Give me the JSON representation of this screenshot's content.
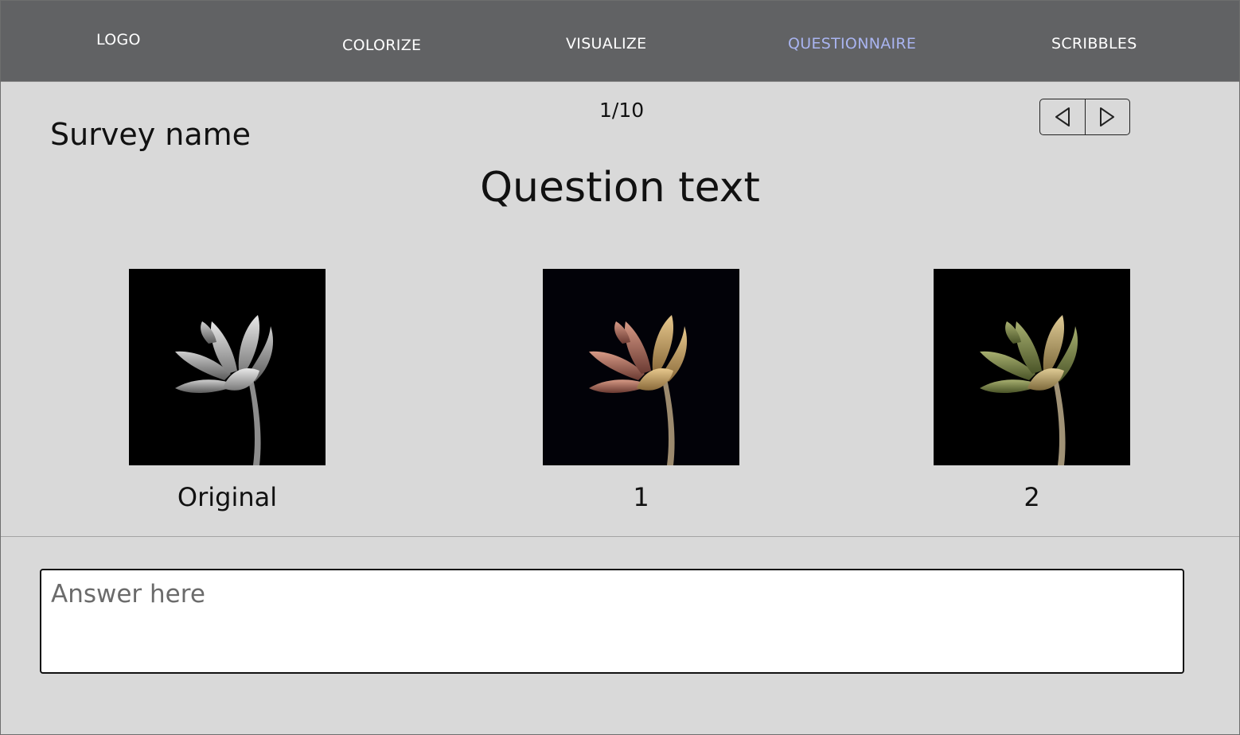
{
  "navbar": {
    "logo": "LOGO",
    "items": [
      {
        "label": "COLORIZE",
        "active": false
      },
      {
        "label": "VISUALIZE",
        "active": false
      },
      {
        "label": "QUESTIONNAIRE",
        "active": true
      },
      {
        "label": "SCRIBBLES",
        "active": false
      }
    ],
    "active_color": "#a9b4f0",
    "background_color": "#616264"
  },
  "survey": {
    "name": "Survey name",
    "page_counter": "1/10",
    "prev_icon": "triangle-left-icon",
    "next_icon": "triangle-right-icon"
  },
  "question": {
    "text": "Question text",
    "options": [
      {
        "caption": "Original",
        "tint": "grayscale"
      },
      {
        "caption": "1",
        "tint": "warm-pink-gold"
      },
      {
        "caption": "2",
        "tint": "olive-gold"
      }
    ]
  },
  "answer": {
    "value": "",
    "placeholder": "Answer here"
  }
}
